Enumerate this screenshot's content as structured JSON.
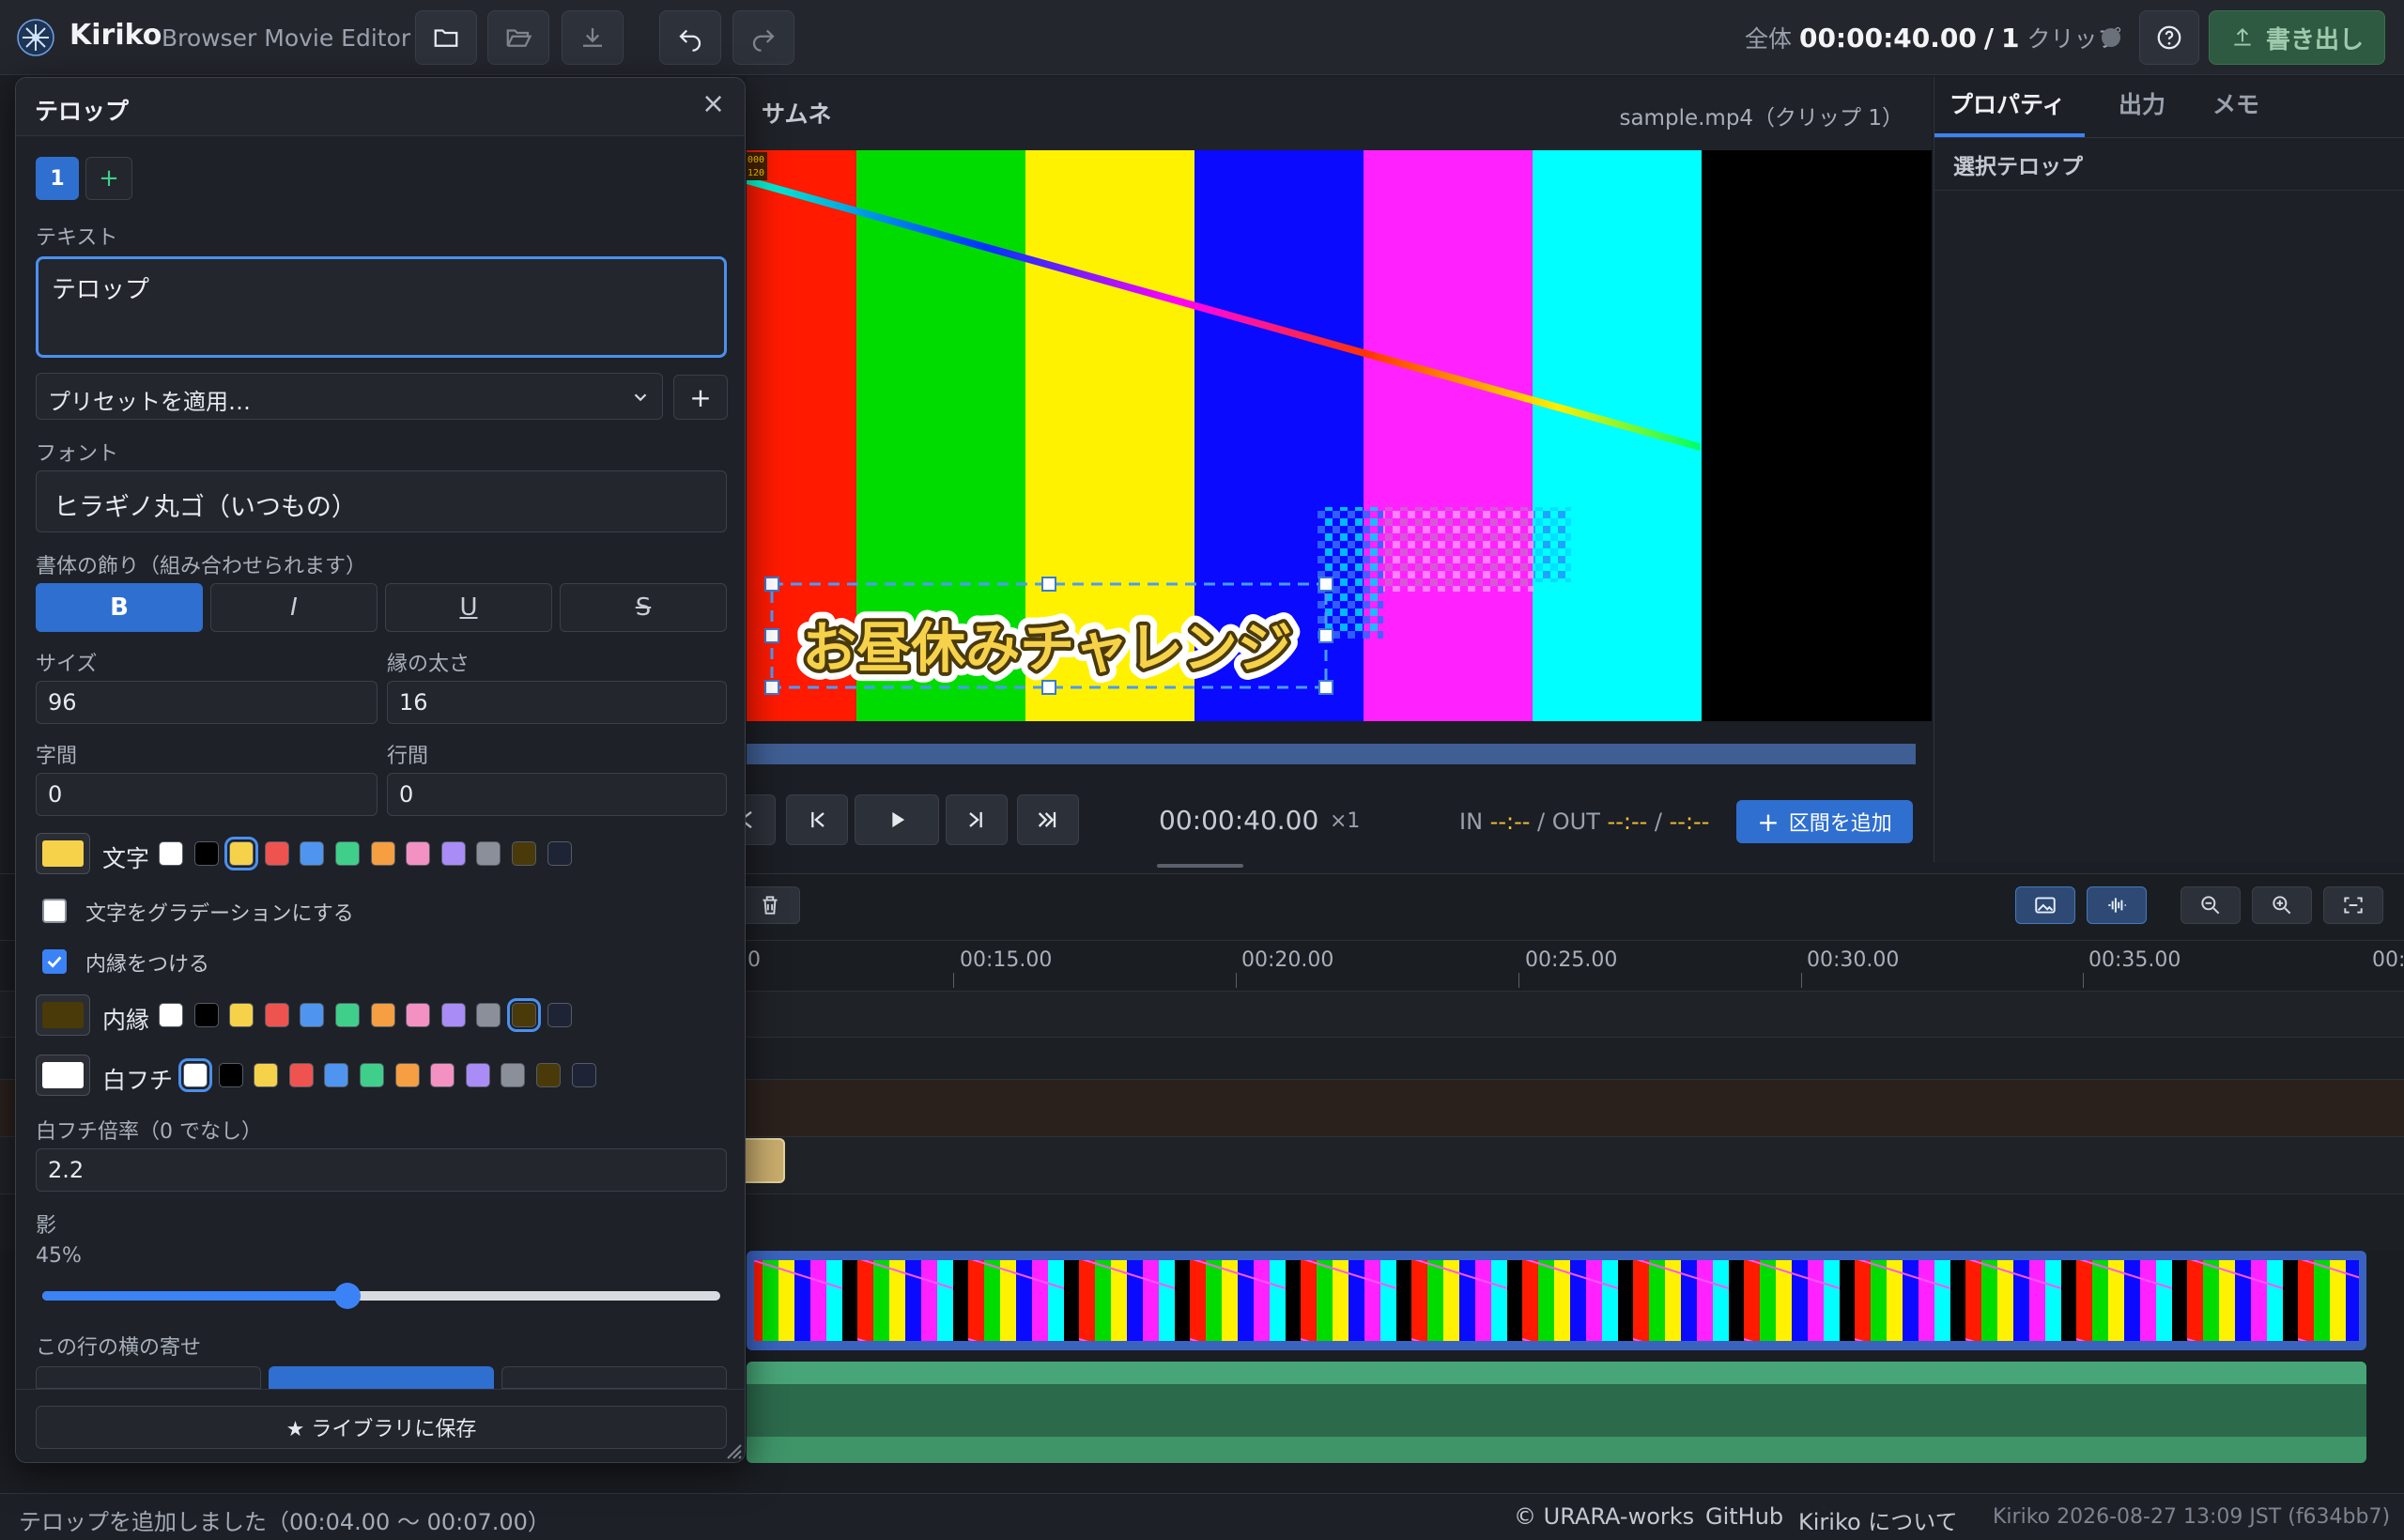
{
  "app": {
    "name": "Kiriko",
    "subtitle": "Browser Movie Editor"
  },
  "header": {
    "total_label": "全体",
    "total_time": "00:00:40.00",
    "sep": "/",
    "clip_count": "1",
    "clip_label": "クリップ",
    "export_label": "書き出し"
  },
  "preview": {
    "tab_label": "サムネ",
    "file_label": "sample.mp4（クリップ 1）",
    "telop_text": "お昼休みチャレンジ",
    "counter_top": "000",
    "counter_bottom": "120"
  },
  "transport": {
    "time": "00:00:40.00",
    "speed": "×1",
    "in_label": "IN",
    "in_value": "--:--",
    "out_label": "/ OUT",
    "out_value": "--:--",
    "out_sep": "/",
    "out_value2": "--:--",
    "add_range": "区間を追加"
  },
  "right_panel": {
    "tabs": [
      "プロパティ",
      "出力",
      "メモ"
    ],
    "section_title": "選択テロップ"
  },
  "timeline": {
    "ticks": [
      "0",
      "00:15.00",
      "00:20.00",
      "00:25.00",
      "00:30.00",
      "00:35.00",
      "00:"
    ]
  },
  "telop_panel": {
    "title": "テロップ",
    "close": "×",
    "tab_number": "1",
    "add_tab": "+",
    "text_label": "テキスト",
    "text_value": "テロップ",
    "preset_placeholder": "プリセットを適用…",
    "preset_add": "+",
    "font_label": "フォント",
    "font_value": "ヒラギノ丸ゴ（いつもの）",
    "style_label": "書体の飾り（組み合わせられます）",
    "style_buttons": [
      "B",
      "I",
      "U",
      "S"
    ],
    "size_label": "サイズ",
    "size_value": "96",
    "stroke_label": "縁の太さ",
    "stroke_value": "16",
    "letter_label": "字間",
    "letter_value": "0",
    "line_label": "行間",
    "line_value": "0",
    "text_color_label": "文字",
    "text_color": "#f6d24a",
    "gradient_label": "文字をグラデーションにする",
    "inner_stroke_check": "内縁をつける",
    "inner_color_label": "内縁",
    "inner_color": "#4a3a0a",
    "white_color_label": "白フチ",
    "white_color": "#ffffff",
    "white_scale_label": "白フチ倍率（0 でなし）",
    "white_scale_value": "2.2",
    "shadow_label": "影",
    "shadow_value": "45%",
    "shadow_fraction": 0.45,
    "align_label": "この行の横の寄せ",
    "save_button": "★ ライブラリに保存"
  },
  "palette": [
    "#ffffff",
    "#000000",
    "#f6d24a",
    "#ef5350",
    "#4f95ef",
    "#3fcf8a",
    "#f59e42",
    "#f291c2",
    "#a98cf5",
    "#8a8f99",
    "#4a3a0a",
    "#1e2436"
  ],
  "status": {
    "message": "テロップを追加しました（00:04.00 〜 00:07.00）",
    "copyright": "© URARA-works",
    "github": "GitHub",
    "about": "Kiriko について",
    "build": "Kiriko 2026-08-27 13:09 JST (f634bb7)"
  }
}
